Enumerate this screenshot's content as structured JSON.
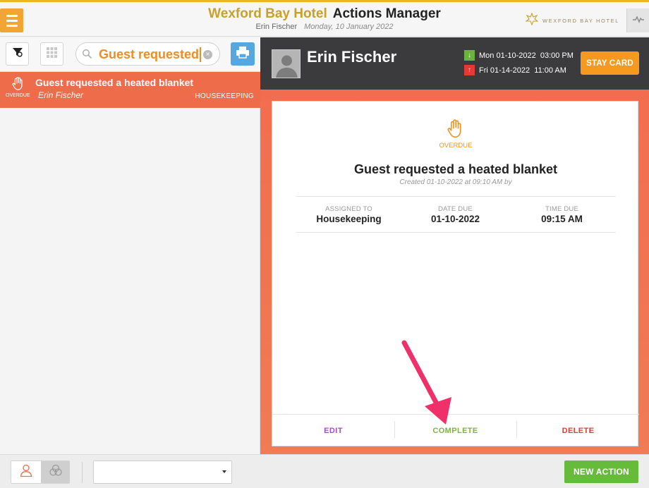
{
  "header": {
    "hotel_name": "Wexford Bay Hotel",
    "app_name": "Actions Manager",
    "user_name": "Erin Fischer",
    "date": "Monday, 10 January 2022",
    "brand_text": "WEXFORD BAY HOTEL"
  },
  "toolbar": {
    "search_value": "Guest requested"
  },
  "list": {
    "items": [
      {
        "title": "Guest requested a heated blanket",
        "guest": "Erin Fischer",
        "department": "HOUSEKEEPING",
        "status": "OVERDUE"
      }
    ]
  },
  "guest": {
    "name": "Erin Fischer",
    "arrival": "Mon 01-10-2022  03:00 PM",
    "departure": "Fri 01-14-2022  11:00 AM",
    "stay_card_label": "STAY CARD"
  },
  "action": {
    "status": "OVERDUE",
    "title": "Guest requested a heated blanket",
    "created": "Created 01-10-2022 at 09:10 AM by",
    "assigned_to_label": "ASSIGNED TO",
    "assigned_to": "Housekeeping",
    "date_due_label": "DATE DUE",
    "date_due": "01-10-2022",
    "time_due_label": "TIME DUE",
    "time_due": "09:15 AM",
    "edit_label": "EDIT",
    "complete_label": "COMPLETE",
    "delete_label": "DELETE"
  },
  "footer": {
    "dropdown_value": "",
    "new_action_label": "NEW ACTION"
  },
  "colors": {
    "brand_gold": "#c7a12a",
    "accent_orange": "#f08c22",
    "overdue_red": "#ef6c4b",
    "edit_purple": "#a64bc8",
    "complete_green": "#7cb342",
    "delete_red": "#e53935",
    "new_action_green": "#66bb3b",
    "arrow_pink": "#f0306b"
  },
  "icons": {
    "menu": "hamburger-icon",
    "filter": "filter-icon",
    "grid": "grid-icon",
    "search": "search-icon",
    "clear": "clear-icon",
    "print": "print-icon",
    "overdue": "raised-hand-icon",
    "arrival": "arrow-down-icon",
    "departure": "arrow-up-icon",
    "pulse": "pulse-icon",
    "brand": "leaf-icon",
    "user": "user-icon",
    "group": "group-icon"
  }
}
